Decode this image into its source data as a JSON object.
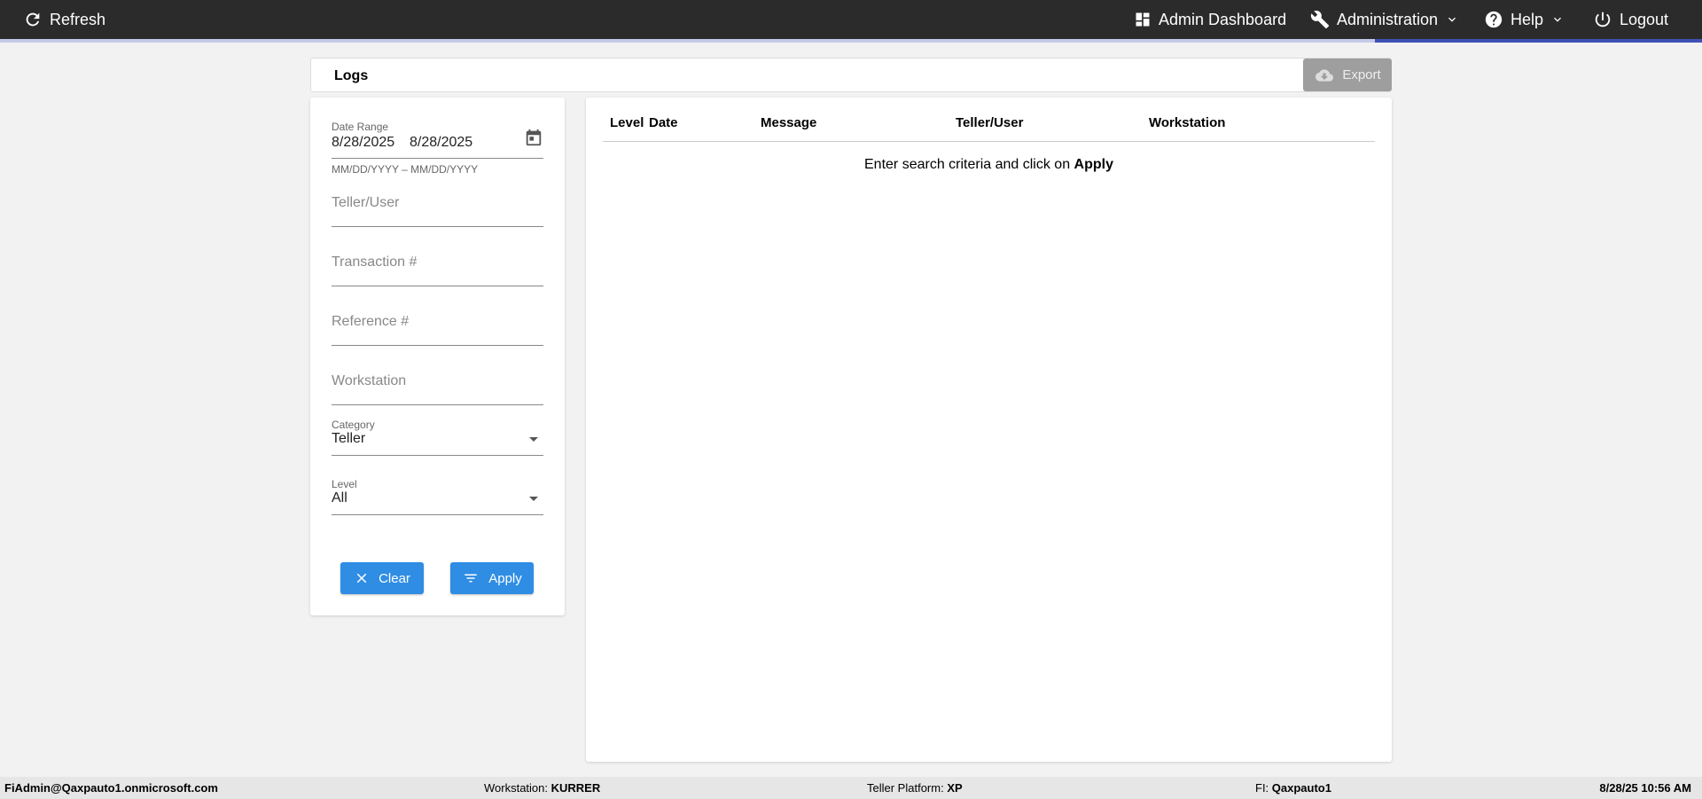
{
  "topbar": {
    "refresh_label": "Refresh",
    "admin_dashboard_label": "Admin Dashboard",
    "administration_label": "Administration",
    "help_label": "Help",
    "logout_label": "Logout"
  },
  "logs": {
    "title": "Logs",
    "export_label": "Export"
  },
  "filters": {
    "date_range_label": "Date Range",
    "date_start": "8/28/2025",
    "date_end": "8/28/2025",
    "date_hint": "MM/DD/YYYY – MM/DD/YYYY",
    "teller_placeholder": "Teller/User",
    "transaction_placeholder": "Transaction #",
    "reference_placeholder": "Reference #",
    "workstation_placeholder": "Workstation",
    "category_label": "Category",
    "category_value": "Teller",
    "level_label": "Level",
    "level_value": "All",
    "clear_label": "Clear",
    "apply_label": "Apply"
  },
  "results": {
    "columns": [
      "Level",
      "Date",
      "Message",
      "Teller/User",
      "Workstation"
    ],
    "empty_prefix": "Enter search criteria and click on ",
    "empty_action": "Apply"
  },
  "status": {
    "user": "FiAdmin@Qaxpauto1.onmicrosoft.com",
    "workstation_label": "Workstation: ",
    "workstation_value": "KURRER",
    "platform_label": "Teller Platform: ",
    "platform_value": "XP",
    "fi_label": "FI: ",
    "fi_value": "Qaxpauto1",
    "datetime": "8/28/25 10:56 AM"
  },
  "colors": {
    "topbar_bg": "#2b2b2b",
    "accent": "#3f51b5",
    "button_blue": "#2f8de4",
    "export_disabled": "#9e9e9e"
  }
}
